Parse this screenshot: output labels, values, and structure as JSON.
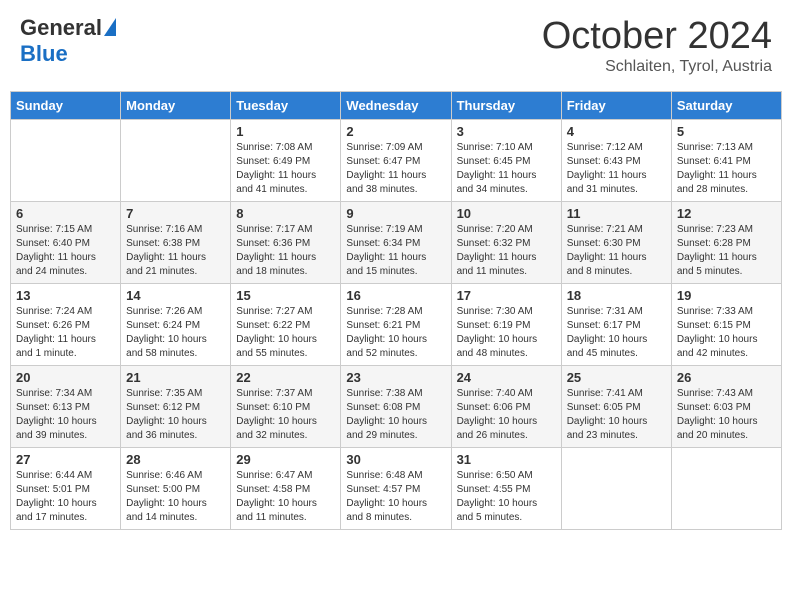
{
  "header": {
    "logo_general": "General",
    "logo_blue": "Blue",
    "month_title": "October 2024",
    "subtitle": "Schlaiten, Tyrol, Austria"
  },
  "weekdays": [
    "Sunday",
    "Monday",
    "Tuesday",
    "Wednesday",
    "Thursday",
    "Friday",
    "Saturday"
  ],
  "weeks": [
    [
      {
        "day": "",
        "info": ""
      },
      {
        "day": "",
        "info": ""
      },
      {
        "day": "1",
        "info": "Sunrise: 7:08 AM\nSunset: 6:49 PM\nDaylight: 11 hours and 41 minutes."
      },
      {
        "day": "2",
        "info": "Sunrise: 7:09 AM\nSunset: 6:47 PM\nDaylight: 11 hours and 38 minutes."
      },
      {
        "day": "3",
        "info": "Sunrise: 7:10 AM\nSunset: 6:45 PM\nDaylight: 11 hours and 34 minutes."
      },
      {
        "day": "4",
        "info": "Sunrise: 7:12 AM\nSunset: 6:43 PM\nDaylight: 11 hours and 31 minutes."
      },
      {
        "day": "5",
        "info": "Sunrise: 7:13 AM\nSunset: 6:41 PM\nDaylight: 11 hours and 28 minutes."
      }
    ],
    [
      {
        "day": "6",
        "info": "Sunrise: 7:15 AM\nSunset: 6:40 PM\nDaylight: 11 hours and 24 minutes."
      },
      {
        "day": "7",
        "info": "Sunrise: 7:16 AM\nSunset: 6:38 PM\nDaylight: 11 hours and 21 minutes."
      },
      {
        "day": "8",
        "info": "Sunrise: 7:17 AM\nSunset: 6:36 PM\nDaylight: 11 hours and 18 minutes."
      },
      {
        "day": "9",
        "info": "Sunrise: 7:19 AM\nSunset: 6:34 PM\nDaylight: 11 hours and 15 minutes."
      },
      {
        "day": "10",
        "info": "Sunrise: 7:20 AM\nSunset: 6:32 PM\nDaylight: 11 hours and 11 minutes."
      },
      {
        "day": "11",
        "info": "Sunrise: 7:21 AM\nSunset: 6:30 PM\nDaylight: 11 hours and 8 minutes."
      },
      {
        "day": "12",
        "info": "Sunrise: 7:23 AM\nSunset: 6:28 PM\nDaylight: 11 hours and 5 minutes."
      }
    ],
    [
      {
        "day": "13",
        "info": "Sunrise: 7:24 AM\nSunset: 6:26 PM\nDaylight: 11 hours and 1 minute."
      },
      {
        "day": "14",
        "info": "Sunrise: 7:26 AM\nSunset: 6:24 PM\nDaylight: 10 hours and 58 minutes."
      },
      {
        "day": "15",
        "info": "Sunrise: 7:27 AM\nSunset: 6:22 PM\nDaylight: 10 hours and 55 minutes."
      },
      {
        "day": "16",
        "info": "Sunrise: 7:28 AM\nSunset: 6:21 PM\nDaylight: 10 hours and 52 minutes."
      },
      {
        "day": "17",
        "info": "Sunrise: 7:30 AM\nSunset: 6:19 PM\nDaylight: 10 hours and 48 minutes."
      },
      {
        "day": "18",
        "info": "Sunrise: 7:31 AM\nSunset: 6:17 PM\nDaylight: 10 hours and 45 minutes."
      },
      {
        "day": "19",
        "info": "Sunrise: 7:33 AM\nSunset: 6:15 PM\nDaylight: 10 hours and 42 minutes."
      }
    ],
    [
      {
        "day": "20",
        "info": "Sunrise: 7:34 AM\nSunset: 6:13 PM\nDaylight: 10 hours and 39 minutes."
      },
      {
        "day": "21",
        "info": "Sunrise: 7:35 AM\nSunset: 6:12 PM\nDaylight: 10 hours and 36 minutes."
      },
      {
        "day": "22",
        "info": "Sunrise: 7:37 AM\nSunset: 6:10 PM\nDaylight: 10 hours and 32 minutes."
      },
      {
        "day": "23",
        "info": "Sunrise: 7:38 AM\nSunset: 6:08 PM\nDaylight: 10 hours and 29 minutes."
      },
      {
        "day": "24",
        "info": "Sunrise: 7:40 AM\nSunset: 6:06 PM\nDaylight: 10 hours and 26 minutes."
      },
      {
        "day": "25",
        "info": "Sunrise: 7:41 AM\nSunset: 6:05 PM\nDaylight: 10 hours and 23 minutes."
      },
      {
        "day": "26",
        "info": "Sunrise: 7:43 AM\nSunset: 6:03 PM\nDaylight: 10 hours and 20 minutes."
      }
    ],
    [
      {
        "day": "27",
        "info": "Sunrise: 6:44 AM\nSunset: 5:01 PM\nDaylight: 10 hours and 17 minutes."
      },
      {
        "day": "28",
        "info": "Sunrise: 6:46 AM\nSunset: 5:00 PM\nDaylight: 10 hours and 14 minutes."
      },
      {
        "day": "29",
        "info": "Sunrise: 6:47 AM\nSunset: 4:58 PM\nDaylight: 10 hours and 11 minutes."
      },
      {
        "day": "30",
        "info": "Sunrise: 6:48 AM\nSunset: 4:57 PM\nDaylight: 10 hours and 8 minutes."
      },
      {
        "day": "31",
        "info": "Sunrise: 6:50 AM\nSunset: 4:55 PM\nDaylight: 10 hours and 5 minutes."
      },
      {
        "day": "",
        "info": ""
      },
      {
        "day": "",
        "info": ""
      }
    ]
  ]
}
